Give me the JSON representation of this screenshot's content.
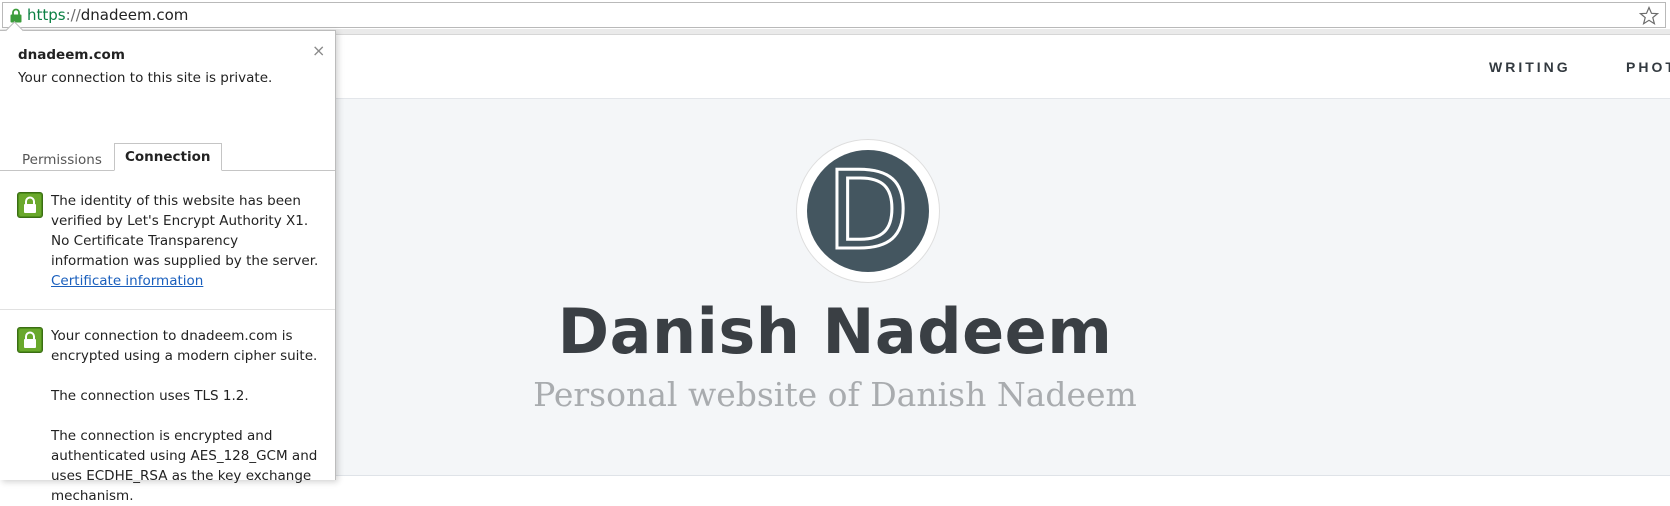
{
  "omnibox": {
    "scheme": "https",
    "separator": "://",
    "host": "dnadeem.com",
    "lock_icon": "lock-icon",
    "star_icon": "star-icon"
  },
  "site": {
    "nav": [
      "WRITING",
      "PHOTO"
    ],
    "avatar_letter": "D",
    "title": "Danish Nadeem",
    "subtitle": "Personal website of Danish Nadeem"
  },
  "popup": {
    "site": "dnadeem.com",
    "status": "Your connection to this site is private.",
    "close_icon": "close-icon",
    "tabs": [
      "Permissions",
      "Connection"
    ],
    "active_tab": "Connection",
    "identity": {
      "lines": [
        "The identity of this website has been",
        "verified by Let's Encrypt Authority X1.",
        "No Certificate Transparency",
        "information was supplied by the server."
      ],
      "link": "Certificate information"
    },
    "connection": {
      "para1": [
        "Your connection to dnadeem.com is",
        "encrypted using a modern cipher suite."
      ],
      "para2": "The connection uses TLS 1.2.",
      "para3": [
        "The connection is encrypted and",
        "authenticated using AES_128_GCM and",
        "uses ECDHE_RSA as the key exchange",
        "mechanism."
      ]
    }
  },
  "colors": {
    "scheme_green": "#0b8043",
    "lock_green": "#4e8f1a",
    "hero_bg": "#f4f6f8",
    "avatar_bg": "#445660",
    "link_blue": "#1a5fbd"
  }
}
